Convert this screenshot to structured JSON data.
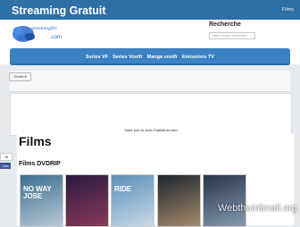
{
  "header": {
    "site_title": "Streaming Gratuit",
    "top_link": "Films",
    "logo_line1": "streamingflix",
    "logo_line2": ".com"
  },
  "search": {
    "label": "Recherche",
    "placeholder": "Tapez ici pour rechercher..."
  },
  "nav": {
    "items": [
      {
        "label": "Series VF"
      },
      {
        "label": "Series Vostfr"
      },
      {
        "label": "Manga vostfr"
      },
      {
        "label": "Emissions TV"
      }
    ]
  },
  "toolbar": {
    "select_label": "Genre"
  },
  "ad": {
    "text": "Votre pub ici avec Publiderie.com"
  },
  "side": {
    "badge": "36",
    "share": "Like"
  },
  "main": {
    "title": "Films",
    "subtitle": "Films DVDRIP",
    "posters": [
      {
        "title": "NO WAY JOSE",
        "color1": "#3b6e8f",
        "color2": "#b7c9d6"
      },
      {
        "title": "",
        "color1": "#281a3e",
        "color2": "#8a3a5a"
      },
      {
        "title": "RIDE",
        "color1": "#5c8fb8",
        "color2": "#c7d9e6"
      },
      {
        "title": "",
        "color1": "#1e2430",
        "color2": "#a38b6a"
      },
      {
        "title": "",
        "color1": "#27354a",
        "color2": "#8699b0"
      }
    ]
  },
  "watermark": "Webthumbnail.org"
}
